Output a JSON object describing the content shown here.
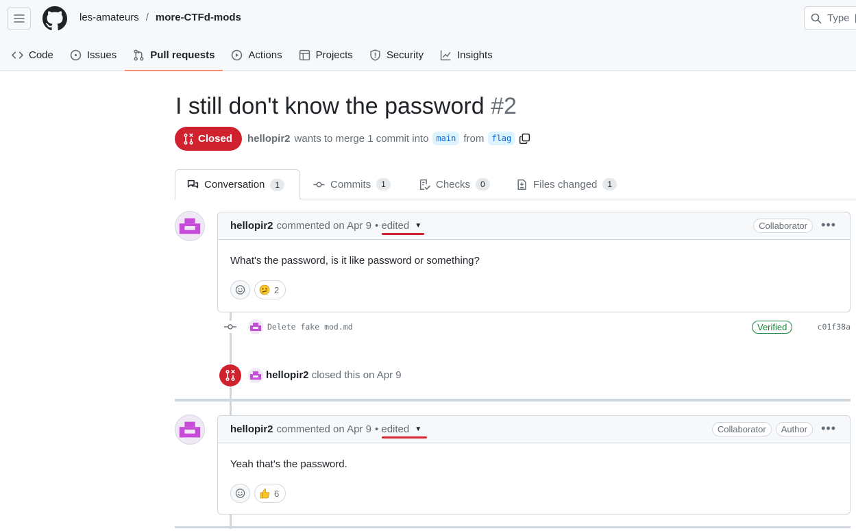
{
  "header": {
    "owner": "les-amateurs",
    "separator": "/",
    "repo": "more-CTFd-mods",
    "search_placeholder": "Type"
  },
  "nav": [
    {
      "label": "Code",
      "icon": "code-icon"
    },
    {
      "label": "Issues",
      "icon": "issue-opened-icon"
    },
    {
      "label": "Pull requests",
      "icon": "git-pull-request-icon",
      "active": true
    },
    {
      "label": "Actions",
      "icon": "play-icon"
    },
    {
      "label": "Projects",
      "icon": "table-icon"
    },
    {
      "label": "Security",
      "icon": "shield-icon"
    },
    {
      "label": "Insights",
      "icon": "graph-icon"
    }
  ],
  "pr": {
    "title": "I still don't know the password",
    "number": "#2",
    "state": "Closed",
    "author": "hellopir2",
    "merge_text": "wants to merge 1 commit into",
    "base_branch": "main",
    "from_text": "from",
    "head_branch": "flag"
  },
  "tabs": [
    {
      "label": "Conversation",
      "count": "1",
      "active": true
    },
    {
      "label": "Commits",
      "count": "1"
    },
    {
      "label": "Checks",
      "count": "0"
    },
    {
      "label": "Files changed",
      "count": "1"
    }
  ],
  "comments": [
    {
      "author": "hellopir2",
      "action": "commented on Apr 9",
      "edited": "• edited",
      "badges": [
        "Collaborator"
      ],
      "body": "What's the password, is it like password or something?",
      "reaction_emoji": "confused-emoji",
      "reaction_count": "2"
    },
    {
      "author": "hellopir2",
      "action": "commented on Apr 9",
      "edited": "• edited",
      "badges": [
        "Collaborator",
        "Author"
      ],
      "body": "Yeah that's the password.",
      "reaction_emoji": "thumbs-up-emoji",
      "reaction_count": "6"
    }
  ],
  "commit": {
    "message": "Delete fake mod.md",
    "verified": "Verified",
    "sha": "c01f38a"
  },
  "close_event": {
    "user": "hellopir2",
    "text": "closed this on Apr 9"
  },
  "colors": {
    "closed": "#cf222e",
    "accent_underline": "#fd8c73",
    "annotation_red": "#d1242f",
    "avatar": "#c64bd8"
  }
}
